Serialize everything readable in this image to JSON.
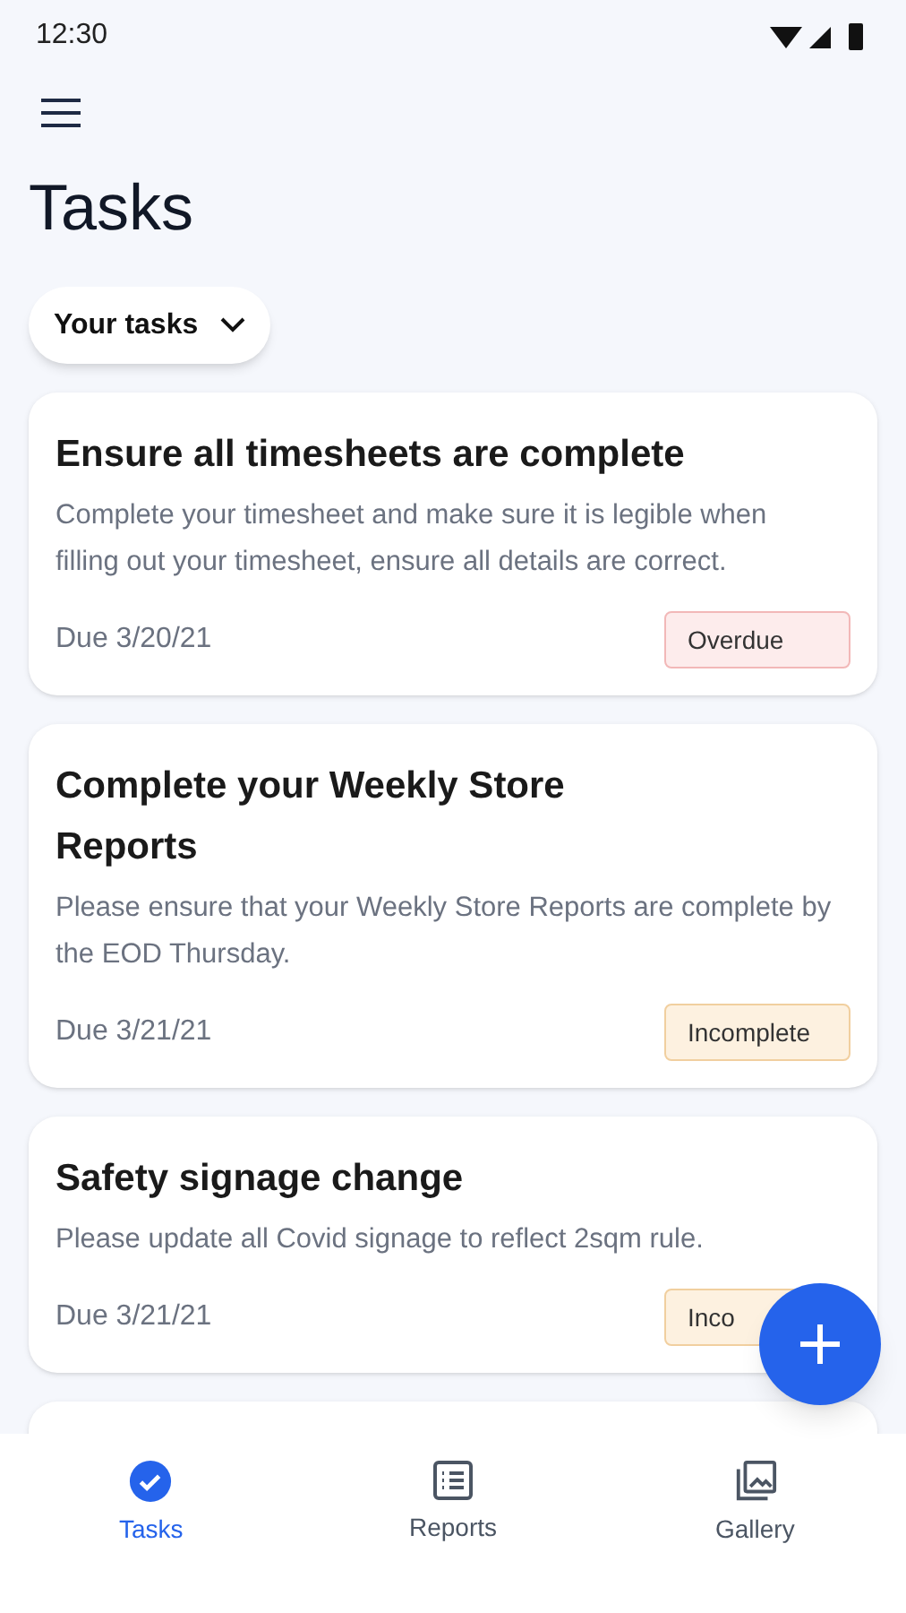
{
  "status_bar": {
    "time": "12:30"
  },
  "title": "Tasks",
  "filter": {
    "label": "Your tasks"
  },
  "tasks": [
    {
      "title": "Ensure all timesheets are complete",
      "description": "Complete your timesheet and make sure it is legible when filling out your timesheet, ensure all details are correct.",
      "due": "Due 3/20/21",
      "status": "Overdue",
      "kind": "overdue"
    },
    {
      "title": "Complete your Weekly Store Reports",
      "description": "Please ensure that your Weekly Store Reports are complete by the EOD Thursday.",
      "due": "Due 3/21/21",
      "status": "Incomplete",
      "kind": "incomplete"
    },
    {
      "title": "Safety signage change",
      "description": "Please update all Covid signage to reflect 2sqm rule.",
      "due": "Due 3/21/21",
      "status": "Inco",
      "kind": "incomplete"
    },
    {
      "kind": "empty"
    }
  ],
  "bottom_nav": [
    {
      "label": "Tasks",
      "selected": true
    },
    {
      "label": "Reports",
      "selected": false
    },
    {
      "label": "Gallery",
      "selected": false
    }
  ]
}
